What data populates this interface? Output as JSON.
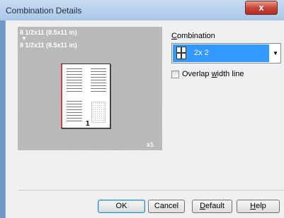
{
  "window": {
    "title": "Combination Details",
    "close_glyph": "x"
  },
  "preview": {
    "paper_line1": "8 1/2x11 (8.5x11 in)",
    "arrow": "▼",
    "paper_line2": "8 1/2x11 (8.5x11 in)",
    "page_number": "1",
    "copies": "x1"
  },
  "combination": {
    "label_accel": "C",
    "label_rest": "ombination",
    "selected": "2x 2"
  },
  "overlap": {
    "label_pre": "Overlap ",
    "label_accel": "w",
    "label_post": "idth line",
    "checked": false
  },
  "buttons": {
    "ok": "OK",
    "cancel": "Cancel",
    "default_accel": "D",
    "default_rest": "efault",
    "help_accel": "H",
    "help_rest": "elp"
  }
}
